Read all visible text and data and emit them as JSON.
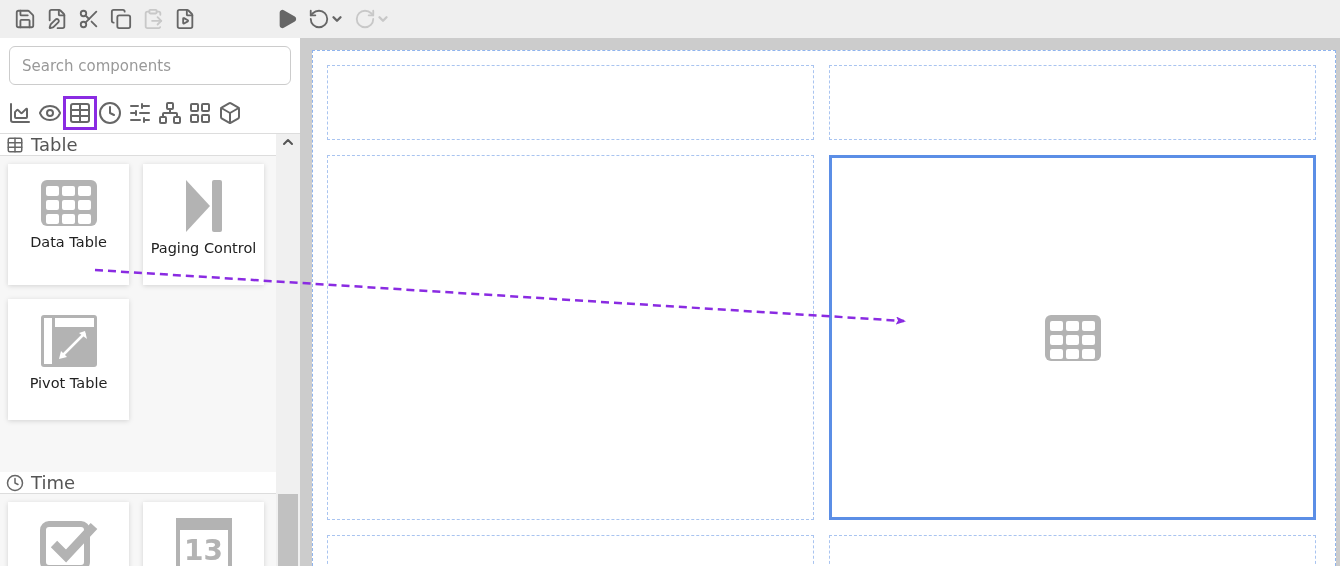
{
  "toolbar": [
    {
      "kind": "save",
      "disabled": false
    },
    {
      "kind": "save-edit",
      "disabled": false
    },
    {
      "kind": "cut",
      "disabled": false
    },
    {
      "kind": "copy",
      "disabled": false
    },
    {
      "kind": "paste",
      "disabled": true
    },
    {
      "kind": "preview",
      "disabled": false
    },
    {
      "kind": "run",
      "disabled": false
    },
    {
      "kind": "undo",
      "disabled": false
    },
    {
      "kind": "redo",
      "disabled": true
    }
  ],
  "search": {
    "placeholder": "Search components"
  },
  "categories": [
    {
      "kind": "chart",
      "selected": false
    },
    {
      "kind": "eye",
      "selected": false
    },
    {
      "kind": "table",
      "selected": true
    },
    {
      "kind": "time",
      "selected": false
    },
    {
      "kind": "filter",
      "selected": false
    },
    {
      "kind": "tree",
      "selected": false
    },
    {
      "kind": "layout",
      "selected": false
    },
    {
      "kind": "cube",
      "selected": false
    }
  ],
  "sections": [
    {
      "kind": "table",
      "title": "Table",
      "items": [
        {
          "kind": "table",
          "label": "Data Table"
        },
        {
          "kind": "paging",
          "label": "Paging Control"
        },
        {
          "kind": "pivot",
          "label": "Pivot Table"
        }
      ]
    },
    {
      "kind": "time",
      "title": "Time",
      "items": [
        {
          "kind": "check"
        },
        {
          "kind": "calendar",
          "icon_text": "13"
        }
      ]
    }
  ],
  "canvas": {
    "cells": [
      {
        "kind": "empty",
        "selected": false
      },
      {
        "kind": "empty",
        "selected": false
      },
      {
        "kind": "empty",
        "selected": false
      },
      {
        "kind": "table",
        "selected": true
      },
      {
        "kind": "empty",
        "selected": false
      },
      {
        "kind": "empty",
        "selected": false
      }
    ]
  }
}
